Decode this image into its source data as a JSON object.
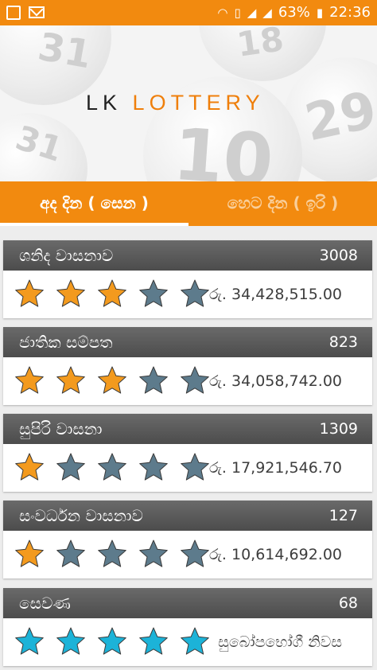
{
  "status_bar": {
    "battery": "63%",
    "time": "22:36",
    "colors": {
      "background": "#f28a0f"
    }
  },
  "banner": {
    "logo_lk": "LK",
    "logo_lottery": "LOTTERY",
    "ball_numbers": [
      "31",
      "18",
      "29",
      "31",
      "10"
    ]
  },
  "tabs": [
    {
      "label": "අද දින ( සෙන )",
      "selected": true
    },
    {
      "label": "හෙට දින ( ඉරි )",
      "selected": false
    }
  ],
  "colors": {
    "accent": "#f28a0f",
    "star_on": "#f39a1e",
    "star_off": "#5d7b8c",
    "star_special": "#1cb3d8",
    "card_header": "#5a5a5a"
  },
  "lotteries": [
    {
      "name": "ශනිද වාසනාව",
      "draw_no": "3008",
      "stars": [
        "on",
        "on",
        "on",
        "off",
        "off"
      ],
      "prize": "රු. 34,428,515.00"
    },
    {
      "name": "ජාතික සම්පත",
      "draw_no": "823",
      "stars": [
        "on",
        "on",
        "on",
        "off",
        "off"
      ],
      "prize": "රු. 34,058,742.00"
    },
    {
      "name": "සුපිරි වාසනා",
      "draw_no": "1309",
      "stars": [
        "on",
        "off",
        "off",
        "off",
        "off"
      ],
      "prize": "රු. 17,921,546.70"
    },
    {
      "name": "සංවර්ධන වාසනාව",
      "draw_no": "127",
      "stars": [
        "on",
        "off",
        "off",
        "off",
        "off"
      ],
      "prize": "රු. 10,614,692.00"
    },
    {
      "name": "සෙවණ",
      "draw_no": "68",
      "stars": [
        "special",
        "special",
        "special",
        "special",
        "special"
      ],
      "prize": "සුබෝපභෝගී නිවස"
    }
  ]
}
